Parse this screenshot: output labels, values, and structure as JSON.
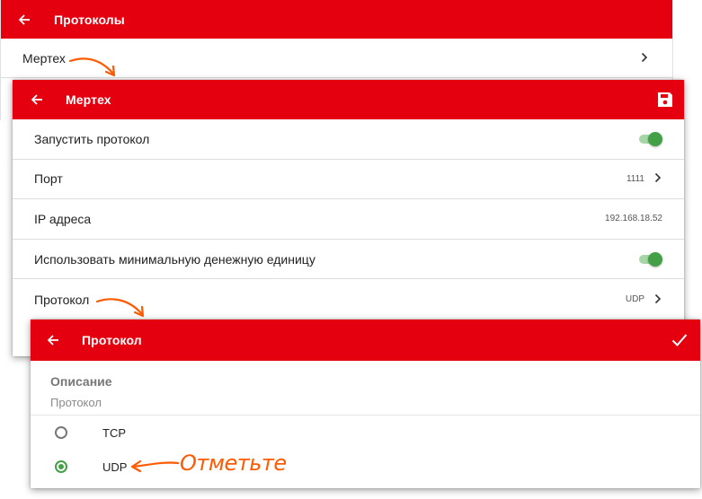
{
  "protocols_screen": {
    "title": "Протоколы",
    "items": [
      {
        "label": "Мертех"
      }
    ]
  },
  "mertech_screen": {
    "title": "Мертех",
    "rows": [
      {
        "label": "Запустить протокол",
        "toggle": true
      },
      {
        "label": "Порт",
        "value": "1111"
      },
      {
        "label": "IP адреса",
        "value": "192.168.18.52"
      },
      {
        "label": "Использовать минимальную денежную единицу",
        "toggle": true
      },
      {
        "label": "Протокол",
        "value": "UDP"
      }
    ]
  },
  "protocol_screen": {
    "title": "Протокол",
    "description_title": "Описание",
    "description_subtitle": "Протокол",
    "options": [
      {
        "label": "TCP",
        "selected": false
      },
      {
        "label": "UDP",
        "selected": true
      }
    ]
  },
  "annotation": {
    "text": "Отметьте"
  },
  "colors": {
    "app_bar": "#e5000f",
    "accent": "#43a047",
    "annotation": "#ff5a00"
  },
  "icons": {
    "back": "arrow-left",
    "save": "floppy-disk",
    "confirm": "check",
    "chevron": "chevron-right"
  }
}
